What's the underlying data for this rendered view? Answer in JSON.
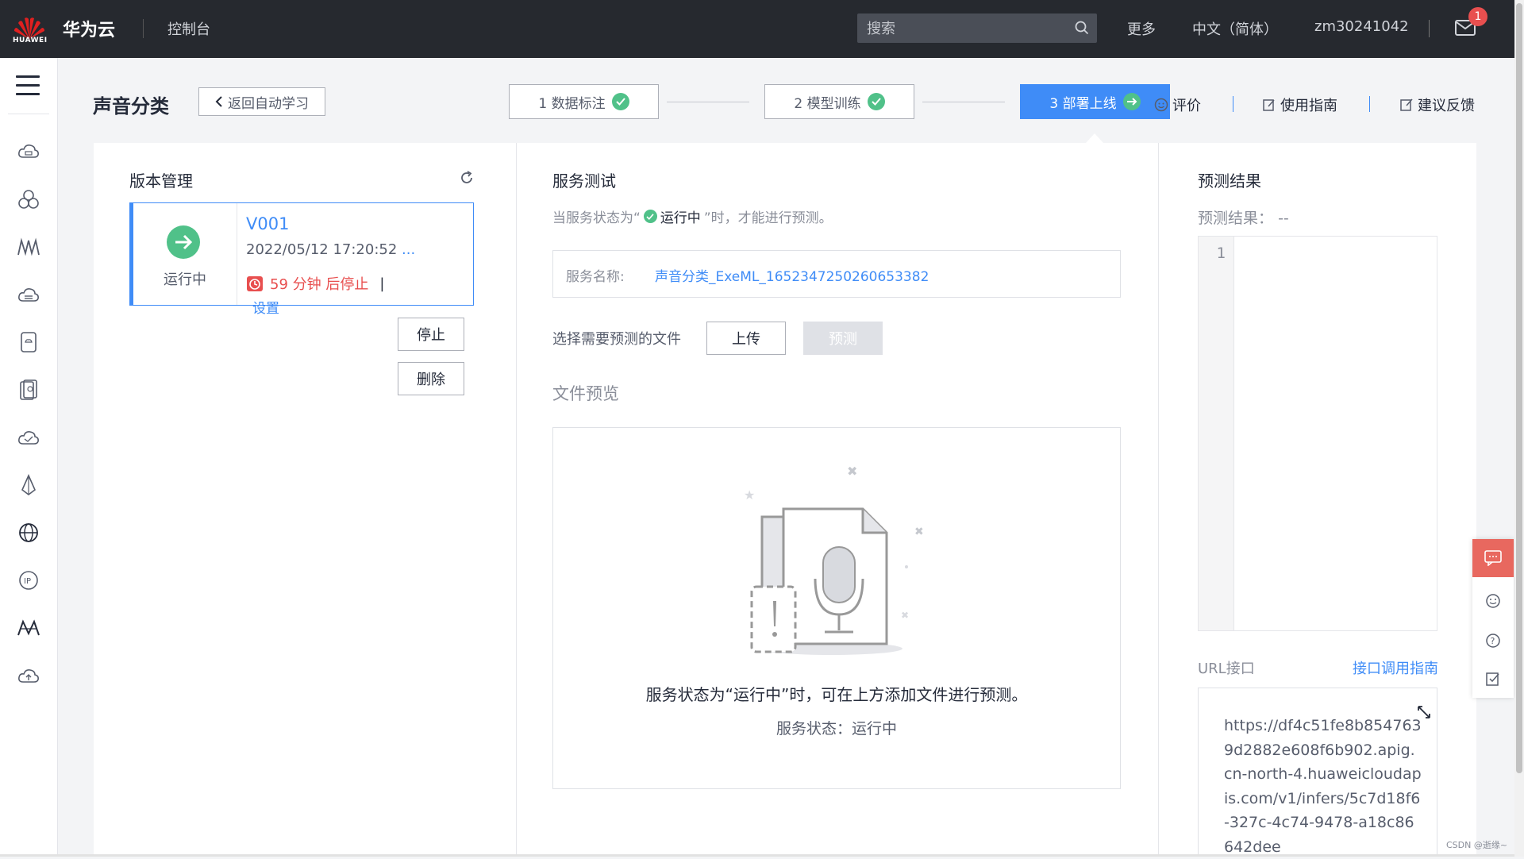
{
  "topbar": {
    "logo_text": "HUAWEI",
    "brand": "华为云",
    "console": "控制台",
    "search_placeholder": "搜索",
    "more": "更多",
    "language": "中文（简体）",
    "username": "zm30241042",
    "mail_badge": "1"
  },
  "sidebar": {
    "icons": [
      "cloud-server-icon",
      "cluster-icon",
      "model-arts-icon",
      "database-icon",
      "storage-icon",
      "backup-icon",
      "cloud-check-icon",
      "deploy-icon",
      "globe-icon",
      "ip-icon",
      "ai-icon",
      "cloud-upload-icon"
    ]
  },
  "header": {
    "title": "声音分类",
    "back_label": "返回自动学习",
    "steps": [
      {
        "label": "1 数据标注",
        "status": "done"
      },
      {
        "label": "2 模型训练",
        "status": "done"
      },
      {
        "label": "3 部署上线",
        "status": "active"
      }
    ],
    "rate": "评价",
    "guide": "使用指南",
    "feedback": "建议反馈"
  },
  "version": {
    "title": "版本管理",
    "status": "运行中",
    "name": "V001",
    "datetime": "2022/05/12 17:20:52",
    "ellipsis": "...",
    "stop_timer": "59 分钟 后停止",
    "pipe": "|",
    "settings": "设置",
    "stop_button": "停止",
    "delete_button": "删除"
  },
  "service_test": {
    "title": "服务测试",
    "hint_prefix": "当服务状态为“",
    "hint_status": "运行中",
    "hint_suffix": "”时，才能进行预测。",
    "service_name_label": "服务名称:",
    "service_name_value": "声音分类_ExeML_1652347250260653382",
    "file_label": "选择需要预测的文件",
    "upload_button": "上传",
    "predict_button": "预测",
    "preview_title": "文件预览",
    "preview_message": "服务状态为“运行中”时，可在上方添加文件进行预测。",
    "preview_status": "服务状态：运行中"
  },
  "prediction": {
    "title": "预测结果",
    "result_label": "预测结果：",
    "result_value": "--",
    "line_number": "1",
    "url_label": "URL接口",
    "url_guide": "接口调用指南",
    "url_value": "https://df4c51fe8b8547639d2882e608f6b902.apig.cn-north-4.huaweicloudapis.com/v1/infers/5c7d18f6-327c-4c74-9478-a18c86642dee"
  },
  "watermark": "CSDN @逝缘~",
  "colors": {
    "topbar_bg": "#26292f",
    "accent": "#3f8cf7",
    "success": "#50c189",
    "danger": "#e84f4f",
    "float_accent": "#e8685f"
  }
}
